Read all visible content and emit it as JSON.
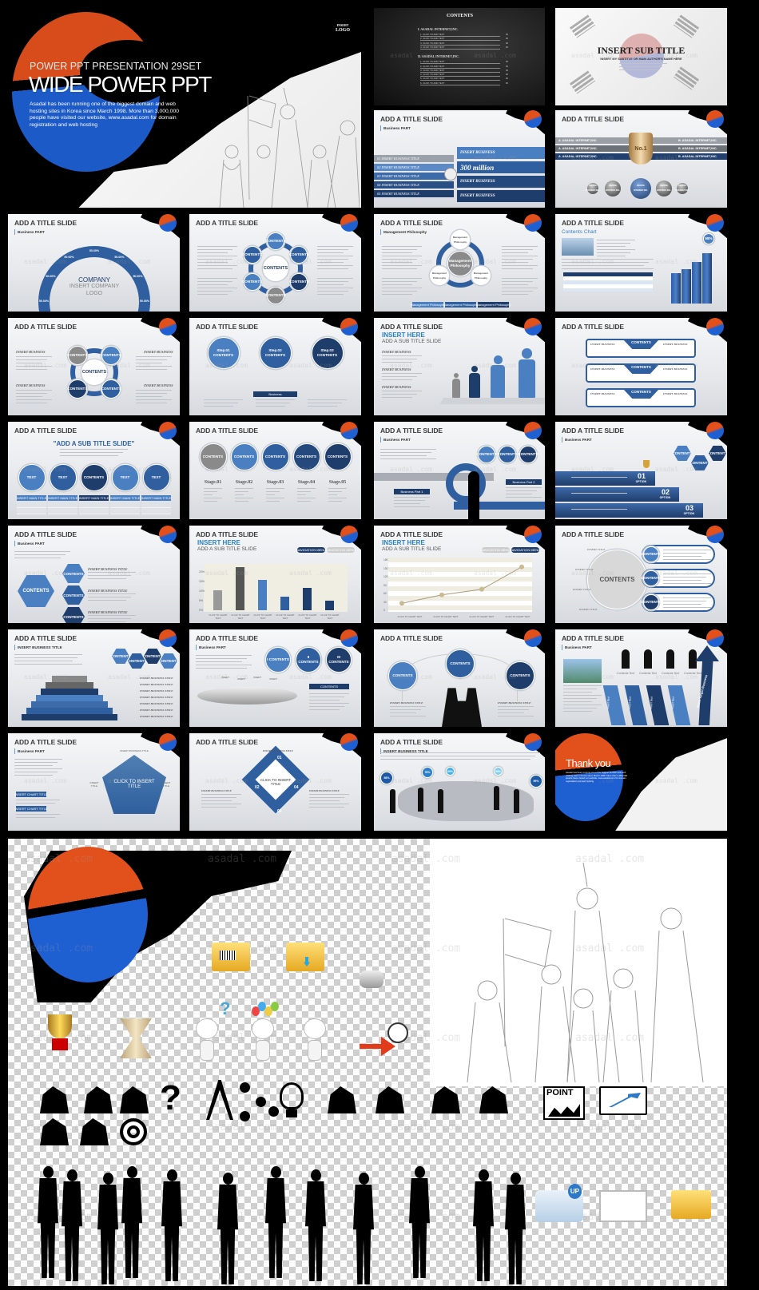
{
  "watermark": "asadal .com",
  "colors": {
    "red": "#e2501c",
    "blue": "#1e5fd2",
    "navy": "#1f3d6b",
    "mid_blue": "#2f5f9e",
    "light_blue": "#4a7fc1",
    "gray": "#8a8a8a"
  },
  "hero": {
    "logo_top": "INSERT",
    "logo_bottom": "LOGO",
    "kicker": "POWER PPT PRESENTATION 29SET",
    "title": "WIDE POWER PPT",
    "body": "Asadal has been running one of the biggest domain and web hosting sites in Korea since March 1998. More than 3,000,000 people have visited our website,  www.asadal.com  for domain registration and web hosting"
  },
  "slides": [
    {
      "kind": "contents",
      "title": "CONTENTS",
      "sections": [
        {
          "label": "I. ASADAL INTERNET,INC.",
          "items": [
            "1. CLICK TO ADD TEXT",
            "2. CLICK TO ADD TEXT",
            "3. CLICK TO ADD TEXT",
            "4. CLICK TO ADD TEXT"
          ]
        },
        {
          "label": "II. ASADAL INTERNET,INC.",
          "items": [
            "1. CLICK TO ADD TEXT",
            "2. CLICK TO ADD TEXT",
            "3. CLICK TO ADD TEXT",
            "4. CLICK TO ADD TEXT",
            "5. CLICK TO ADD TEXT",
            "6. CLICK TO ADD TEXT"
          ]
        }
      ],
      "page": "00"
    },
    {
      "kind": "subtitle",
      "title": "INSERT SUB TITLE",
      "subtitle": "INSERT MY SUBTITLE OR MAIN AUTHOR'S NAME HERE"
    },
    {
      "kind": "bands",
      "title": "ADD A TITLE SLIDE",
      "sub": "Business PART",
      "items": [
        "01 INSERT BUSINESS TITLE",
        "02 INSERT BUSINESS TITLE",
        "03 INSERT BUSINESS TITLE",
        "04 INSERT BUSINESS TITLE",
        "05 INSERT BUSINESS TITLE"
      ],
      "callouts": [
        "INSERT BUSINESS",
        "300 million",
        "INSERT BUSINESS",
        "INSERT BUSINESS"
      ]
    },
    {
      "kind": "trophy",
      "title": "ADD A TITLE SLIDE",
      "left": [
        "A. ASADAL INTERNET,INC.",
        "A. ASADAL INTERNET,INC.",
        "A. ASADAL INTERNET,INC."
      ],
      "right": [
        "B. ASADAL INTERNET,INC.",
        "B. ASADAL INTERNET,INC.",
        "B. ASADAL INTERNET,INC."
      ],
      "center": "No.1",
      "spheres": [
        "ASADAL INTERNET,INC.",
        "ASADAL INTERNET,INC.",
        "ASADAL INTERNET,INC.",
        "ASADAL INTERNET,INC.",
        "ASADAL INTERNET,INC."
      ]
    },
    {
      "kind": "arc",
      "title": "ADD A TITLE SLIDE",
      "sub": "Business PART",
      "items": [
        "50.00%",
        "50.00%",
        "50.00%",
        "50.00%",
        "50.00%",
        "50.00%",
        "50.00%"
      ],
      "center": [
        "COMPANY",
        "INSERT COMPANY",
        "LOGO"
      ]
    },
    {
      "kind": "ring",
      "title": "ADD A TITLE SLIDE",
      "center": "CONTENTS",
      "items": [
        "CONTENTS",
        "CONTENTS",
        "CONTENTS",
        "CONTENTS",
        "CONTENTS",
        "CONTENTS"
      ]
    },
    {
      "kind": "ring",
      "title": "ADD A TITLE SLIDE",
      "sub": "Management Philosophy",
      "center": "Management Philosophy",
      "items": [
        "Management Philosophy",
        "Management Philosophy",
        "Management Philosophy"
      ],
      "buttons": [
        "Management Philosophy",
        "Management Philosophy",
        "Management Philosophy"
      ]
    },
    {
      "kind": "bars3d",
      "title": "ADD A TITLE SLIDE",
      "heading": "Contents Chart",
      "values": [
        55,
        62,
        75,
        90
      ],
      "badge": "98%"
    },
    {
      "kind": "ring",
      "title": "ADD A TITLE SLIDE",
      "center": "CONTENTS",
      "items": [
        "CONTENTS",
        "CONTENTS",
        "CONTENTS",
        "CONTENTS"
      ],
      "captions": [
        "INSERT BUSINESS",
        "INSERT BUSINESS",
        "INSERT BUSINESS",
        "INSERT BUSINESS"
      ]
    },
    {
      "kind": "stages",
      "title": "ADD A TITLE SLIDE",
      "items": [
        "Step.01 CONTENTS",
        "Step.02 CONTENTS",
        "Step.03 CONTENTS"
      ],
      "captions": [
        "",
        "Business",
        ""
      ]
    },
    {
      "kind": "people",
      "title": "ADD A TITLE SLIDE",
      "heading": "INSERT HERE",
      "subheading": "ADD A SUB TITLE SLIDE",
      "captions": [
        "INSERT BUSINESS",
        "INSERT BUSINESS",
        "INSERT BUSINESS"
      ]
    },
    {
      "kind": "banners",
      "title": "ADD A TITLE SLIDE",
      "items": [
        "CONTENTS",
        "CONTENTS",
        "CONTENTS"
      ],
      "captions": [
        "INSERT BUSINESS",
        "INSERT BUSINESS"
      ]
    },
    {
      "kind": "stages",
      "title": "ADD A TITLE SLIDE",
      "heading": "\"ADD A SUB TITLE SLIDE\"",
      "items": [
        "TEXT",
        "TEXT",
        "CONTENTS",
        "TEXT",
        "TEXT"
      ],
      "captions": [
        "INSERT MAIN TITLE",
        "INSERT MAIN TITLE",
        "INSERT MAIN TITLE",
        "INSERT MAIN TITLE",
        "INSERT MAIN TITLE"
      ]
    },
    {
      "kind": "stages",
      "title": "ADD A TITLE SLIDE",
      "items": [
        "CONTENTS",
        "CONTENTS",
        "CONTENTS",
        "CONTENTS",
        "CONTENTS"
      ],
      "captions": [
        "Stage.01",
        "Stage.02",
        "Stage.03",
        "Stage.04",
        "Stage.05"
      ]
    },
    {
      "kind": "arrows",
      "title": "ADD A TITLE SLIDE",
      "sub": "Business PART",
      "items": [
        "CONTENTS",
        "CONTENTS",
        "CONTENTS"
      ],
      "captions": [
        "Business Part 1",
        "Business Part 2"
      ]
    },
    {
      "kind": "stairs",
      "title": "ADD A TITLE SLIDE",
      "sub": "Business PART",
      "items": [
        "01",
        "02",
        "03"
      ],
      "tag": "OPTION",
      "hexes": [
        "CONTENTS",
        "CONTENTS",
        "CONTENTS"
      ]
    },
    {
      "kind": "hexes",
      "title": "ADD A TITLE SLIDE",
      "sub": "Business PART",
      "center": "CONTENTS",
      "items": [
        "CONTENTS",
        "CONTENTS",
        "CONTENTS"
      ],
      "captions": [
        "INSERT BUSINESS TITLE",
        "INSERT BUSINESS TITLE",
        "INSERT BUSINESS TITLE"
      ]
    },
    {
      "kind": "bars",
      "title": "ADD A TITLE SLIDE",
      "heading": "INSERT HERE",
      "subheading": "ADD A SUB TITLE SLIDE",
      "buttons": [
        "NAVIGATION MENU",
        "NAVIGATION MENU"
      ],
      "chart": {
        "yticks": [
          "0%",
          "5%",
          "10%",
          "15%",
          "20%"
        ],
        "ylim": [
          0,
          25
        ],
        "values": [
          11,
          24,
          17,
          7.5,
          12.5,
          5.5
        ],
        "labels": [
          "CLICK TO CHART TEXT",
          "CLICK TO CHART TEXT",
          "CLICK TO CHART TEXT",
          "CLICK TO CHART TEXT",
          "CLICK TO CHART TEXT",
          "CLICK TO CHART TEXT"
        ]
      }
    },
    {
      "kind": "line",
      "title": "ADD A TITLE SLIDE",
      "heading": "INSERT HERE",
      "subheading": "ADD A SUB TITLE SLIDE",
      "buttons": [
        "NAVIGATION MENU",
        "NAVIGATION MENU"
      ],
      "chart": {
        "yticks": [
          "0",
          "30",
          "60",
          "90",
          "120",
          "150",
          "180"
        ],
        "ylim": [
          0,
          180
        ],
        "values": [
          25,
          55,
          75,
          155
        ],
        "labels": [
          "CLICK TO CHART TEXT",
          "CLICK TO CHART TEXT",
          "CLICK TO CHART TEXT",
          "CLICK TO CHART TEXT"
        ]
      }
    },
    {
      "kind": "bigcircle",
      "title": "ADD A TITLE SLIDE",
      "center": "CONTENTS",
      "items": [
        "CONTENTS",
        "CONTENTS",
        "CONTENTS"
      ],
      "captions": [
        "INSERT TITLE",
        "INSERT TITLE",
        "INSERT TITLE",
        "INSERT TITLE"
      ]
    },
    {
      "kind": "pyramid",
      "title": "ADD A TITLE SLIDE",
      "sub": "INSERT BUSINESS TITLE",
      "items": [
        "CONTENTS",
        "CONTENTS",
        "CONTENTS",
        "CONTENTS"
      ],
      "captions": [
        "INSERT BUSINESS TITLE",
        "INSERT BUSINESS TITLE",
        "INSERT BUSINESS TITLE",
        "INSERT BUSINESS TITLE",
        "INSERT BUSINESS TITLE",
        "INSERT BUSINESS TITLE",
        "INSERT BUSINESS TITLE"
      ]
    },
    {
      "kind": "pod",
      "title": "ADD A TITLE SLIDE",
      "sub": "Business PART",
      "items": [
        "I CONTENTS",
        "II CONTENTS",
        "III CONTENTS"
      ],
      "captions": [
        "INSERT",
        "INSERT",
        "INSERT",
        "INSERT"
      ],
      "tag": "CONTENTS"
    },
    {
      "kind": "handshake",
      "title": "ADD A TITLE SLIDE",
      "items": [
        "CONTENTS",
        "CONTENTS",
        "CONTENTS"
      ],
      "captions": [
        "INSERT BUSINESS TITLE",
        "INSERT BUSINESS TITLE"
      ]
    },
    {
      "kind": "zigzag",
      "title": "ADD A TITLE SLIDE",
      "sub": "Business PART",
      "items": [
        "Contents Text",
        "Contents Text",
        "Contents Text",
        "Contents Text"
      ],
      "captions": [
        "Insert Text",
        "Insert Text",
        "Insert Text",
        "Insert Text"
      ],
      "arrow": "Insert Target Business"
    },
    {
      "kind": "pentagon",
      "title": "ADD A TITLE SLIDE",
      "sub": "Business PART",
      "center": "CLICK TO INSERT TITLE",
      "items": [
        "INSERT BUSINESS TITLE",
        "INSERT TITLE",
        "INSERT TITLE"
      ],
      "buttons": [
        "INSERT CHART TITLE",
        "INSERT CHART TITLE"
      ]
    },
    {
      "kind": "diamond",
      "title": "ADD A TITLE SLIDE",
      "center": "CLICK TO INSERT TITLE",
      "items": [
        "01",
        "02",
        "03",
        "04"
      ],
      "captions": [
        "INSERT BUSINESS TITLE",
        "INSERT BUSINESS TITLE",
        "INSERT BUSINESS TITLE"
      ]
    },
    {
      "kind": "map",
      "title": "ADD A TITLE SLIDE",
      "sub": "INSERT BUSINESS TITLE",
      "items": [
        "98%",
        "78%",
        "89%",
        "58%",
        "99%"
      ]
    },
    {
      "kind": "thankyou",
      "title": "Thank you",
      "body": "Asadal has been running one of the biggest domain and web hosting sites in Korea since March 1998. More than 3,000,000 people have visited our website, www.asadal.com for domain registration and web hosting"
    }
  ],
  "assets": {
    "icons_row1": [
      "folder-lock-icon",
      "folder-download-icon",
      "robot-dog-icon"
    ],
    "icons_row2": [
      "trophy-icon",
      "hourglass-money-icon",
      "robot-question-icon",
      "robot-balloons-icon",
      "robot-laptop-icon",
      "robot-arrow-icon"
    ],
    "pictograms": [
      "piggy-bank-icon",
      "hourglass-icon",
      "lock-icon",
      "question-icon",
      "compass-icon",
      "molecule-icon",
      "lightbulb-icon",
      "clothes-icon",
      "car-cinema-icon",
      "gas-car-icon",
      "store-icon",
      "point-chart-icon",
      "laptop-chart-icon",
      "chart-growth-icon",
      "mobile-touch-icon",
      "target-icon"
    ],
    "point_label": "POINT",
    "up_label": "UP",
    "silhouettes": 12
  }
}
